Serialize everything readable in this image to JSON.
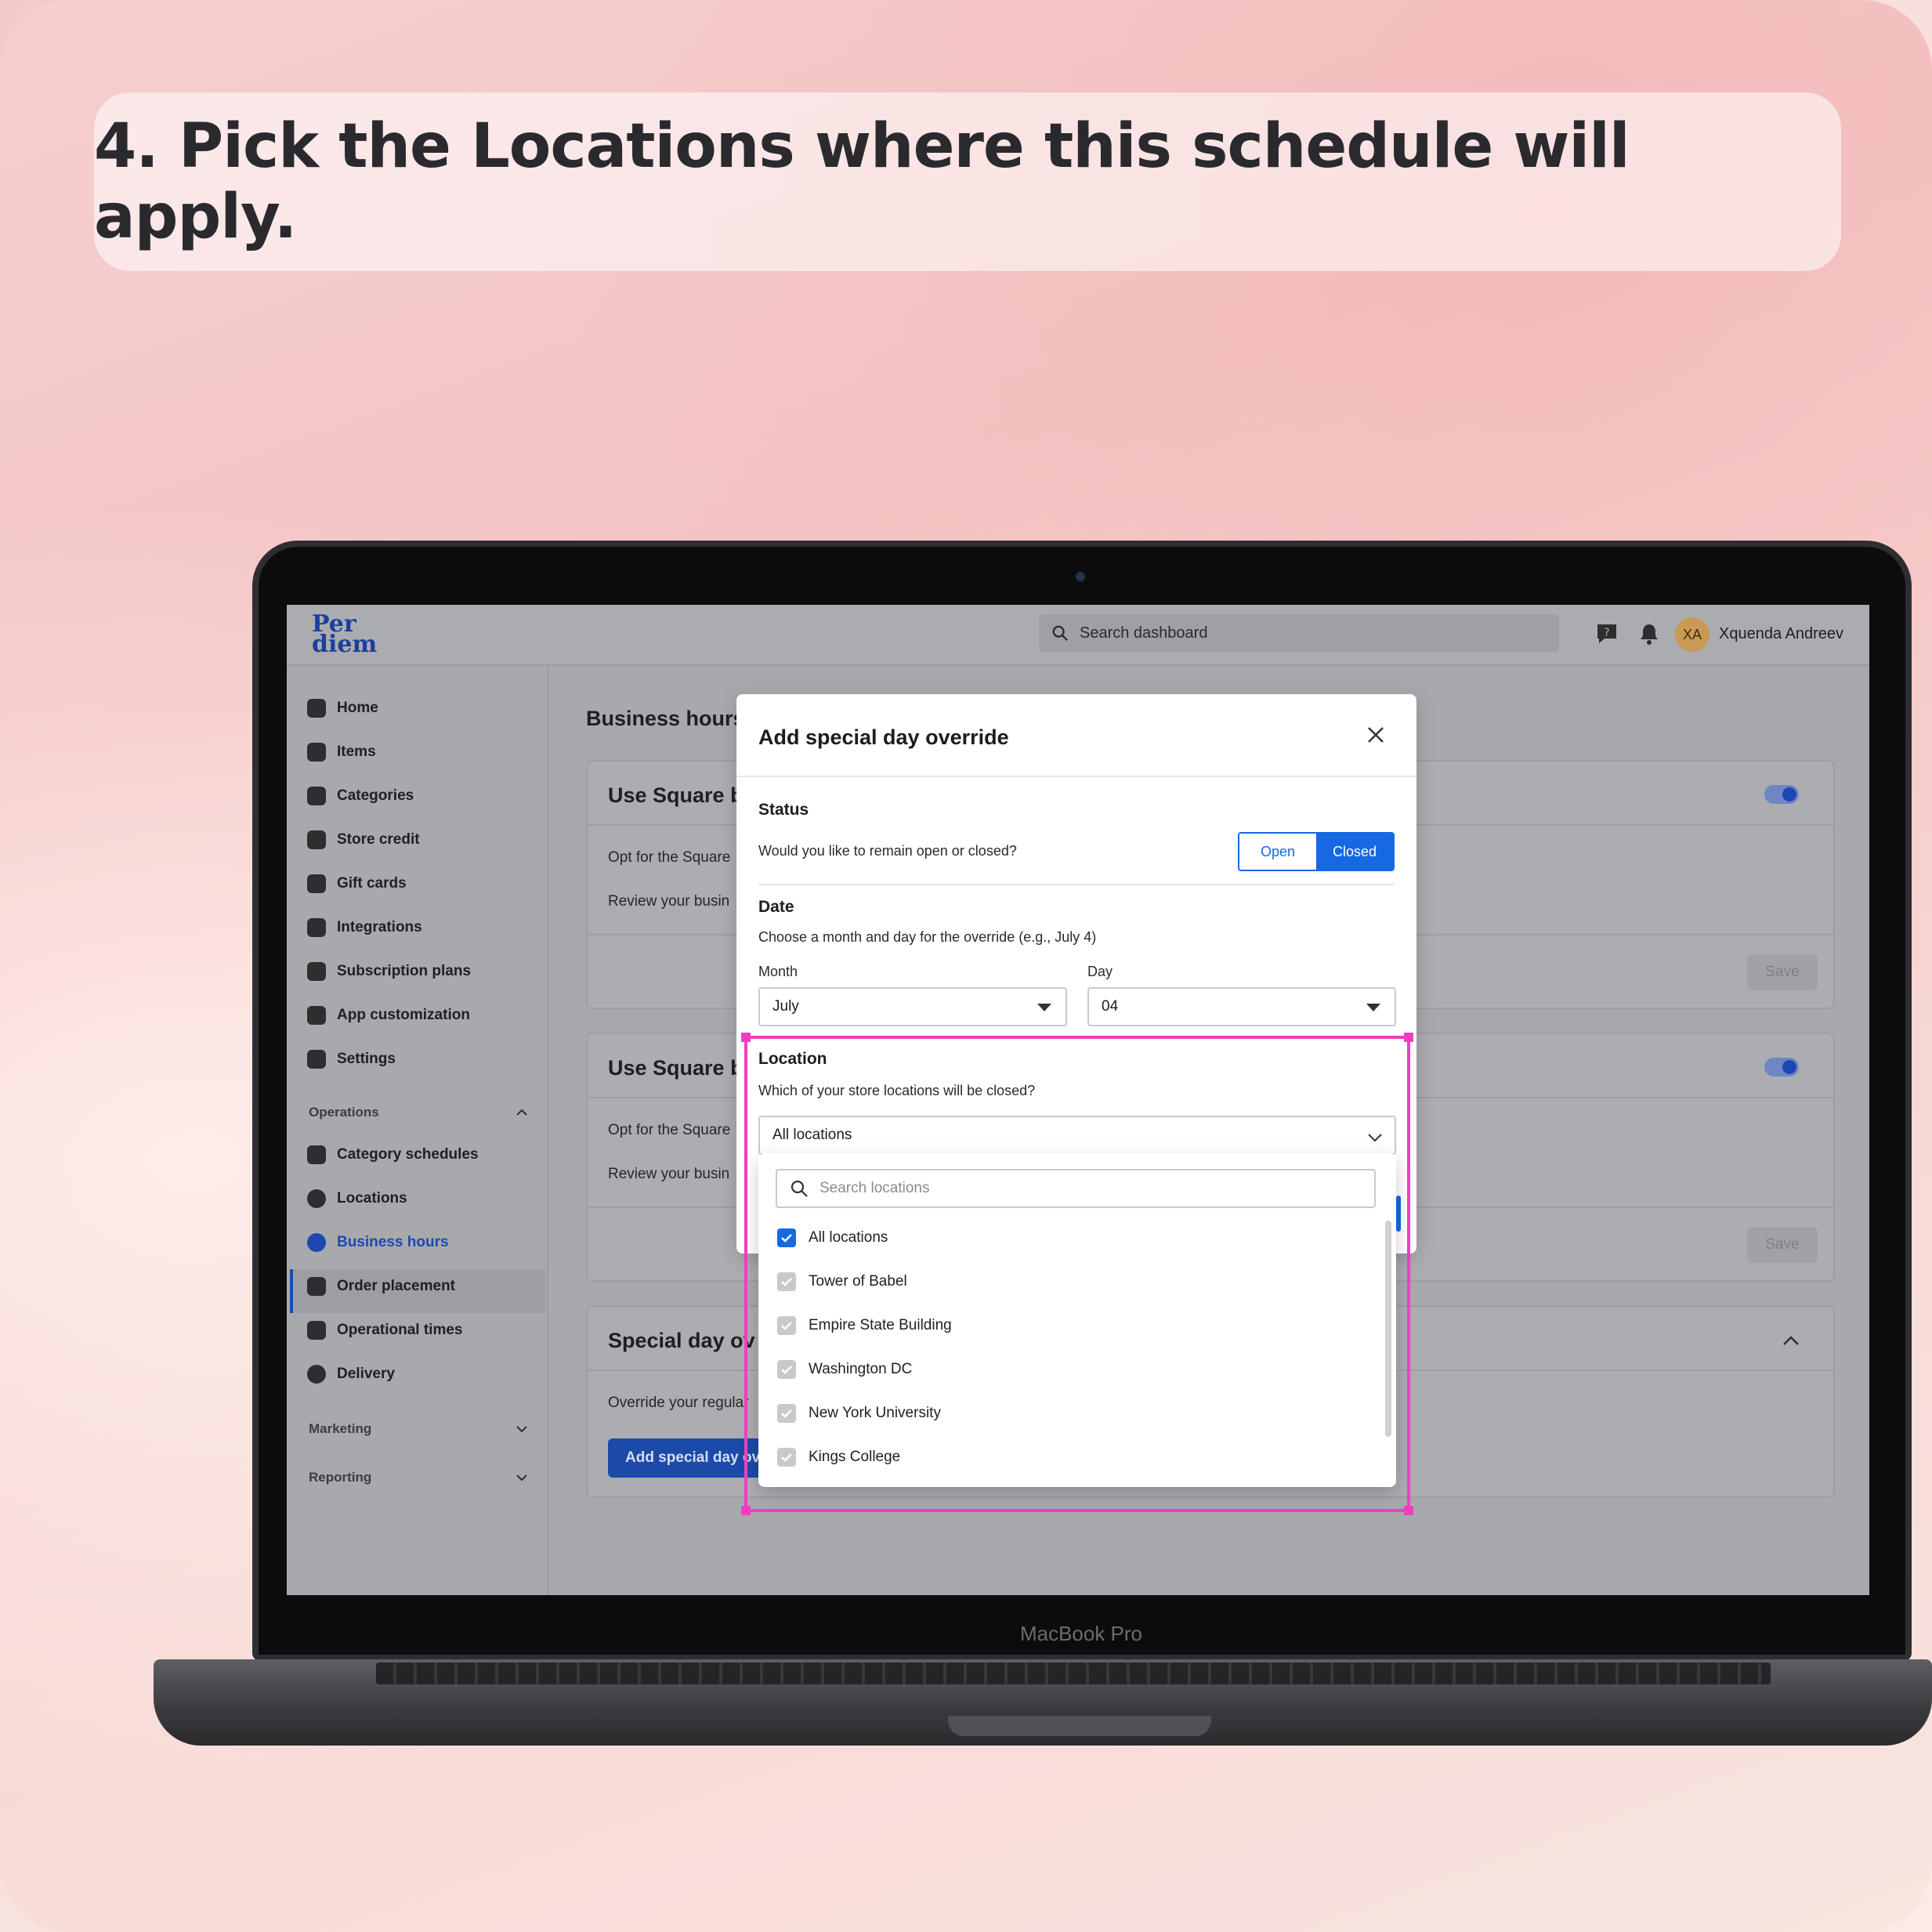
{
  "caption": "4. Pick the Locations where this schedule will apply.",
  "device_label": "MacBook Pro",
  "app": {
    "logo": [
      "Per",
      "diem"
    ],
    "search_placeholder": "Search dashboard",
    "user": {
      "initials": "XA",
      "name": "Xquenda Andreev"
    }
  },
  "sidebar": {
    "items": [
      {
        "label": "Home",
        "icon": "home-icon"
      },
      {
        "label": "Items",
        "icon": "list-icon"
      },
      {
        "label": "Categories",
        "icon": "grid-icon"
      },
      {
        "label": "Store credit",
        "icon": "coin-icon"
      },
      {
        "label": "Gift cards",
        "icon": "gift-icon"
      },
      {
        "label": "Integrations",
        "icon": "plug-icon"
      },
      {
        "label": "Subscription plans",
        "icon": "subscription-icon"
      },
      {
        "label": "App customization",
        "icon": "brush-icon"
      },
      {
        "label": "Settings",
        "icon": "gear-icon"
      }
    ],
    "operations_label": "Operations",
    "operations_items": [
      {
        "label": "Category schedules",
        "icon": "bookmark-icon"
      },
      {
        "label": "Locations",
        "icon": "pin-icon"
      },
      {
        "label": "Business hours",
        "icon": "clock-icon",
        "active": true
      },
      {
        "label": "Order placement",
        "icon": "bag-icon"
      },
      {
        "label": "Operational times",
        "icon": "calendar-icon"
      },
      {
        "label": "Delivery",
        "icon": "pin-icon"
      }
    ],
    "marketing_label": "Marketing",
    "reporting_label": "Reporting"
  },
  "content": {
    "title": "Business hours",
    "card1": {
      "title": "Use Square b",
      "line1": "Opt for the Square",
      "line2": "Review your busin",
      "save": "Save"
    },
    "card2": {
      "title": "Use Square b",
      "line1": "Opt for the Square",
      "line2": "Review your busin",
      "save": "Save"
    },
    "card3": {
      "title": "Special day ov",
      "line1": "Override your regular",
      "button": "Add special day ov"
    }
  },
  "modal": {
    "title": "Add special day override",
    "status": {
      "title": "Status",
      "question": "Would you like to remain open or closed?",
      "options": [
        "Open",
        "Closed"
      ],
      "selected": "Closed"
    },
    "date": {
      "title": "Date",
      "help": "Choose a month and day for the override (e.g., July 4)",
      "month_label": "Month",
      "month_value": "July",
      "day_label": "Day",
      "day_value": "04"
    },
    "location": {
      "title": "Location",
      "question": "Which of your store locations will be closed?",
      "value": "All locations",
      "search_placeholder": "Search locations",
      "options": [
        {
          "label": "All locations",
          "checked": true
        },
        {
          "label": "Tower of Babel",
          "checked": true
        },
        {
          "label": "Empire State Building",
          "checked": true
        },
        {
          "label": "Washington DC",
          "checked": true
        },
        {
          "label": "New York University",
          "checked": true
        },
        {
          "label": "Kings College",
          "checked": true
        }
      ]
    }
  },
  "colors": {
    "accent": "#1668e3",
    "highlight": "#ef3fbf",
    "brand": "#1c3f9a"
  }
}
